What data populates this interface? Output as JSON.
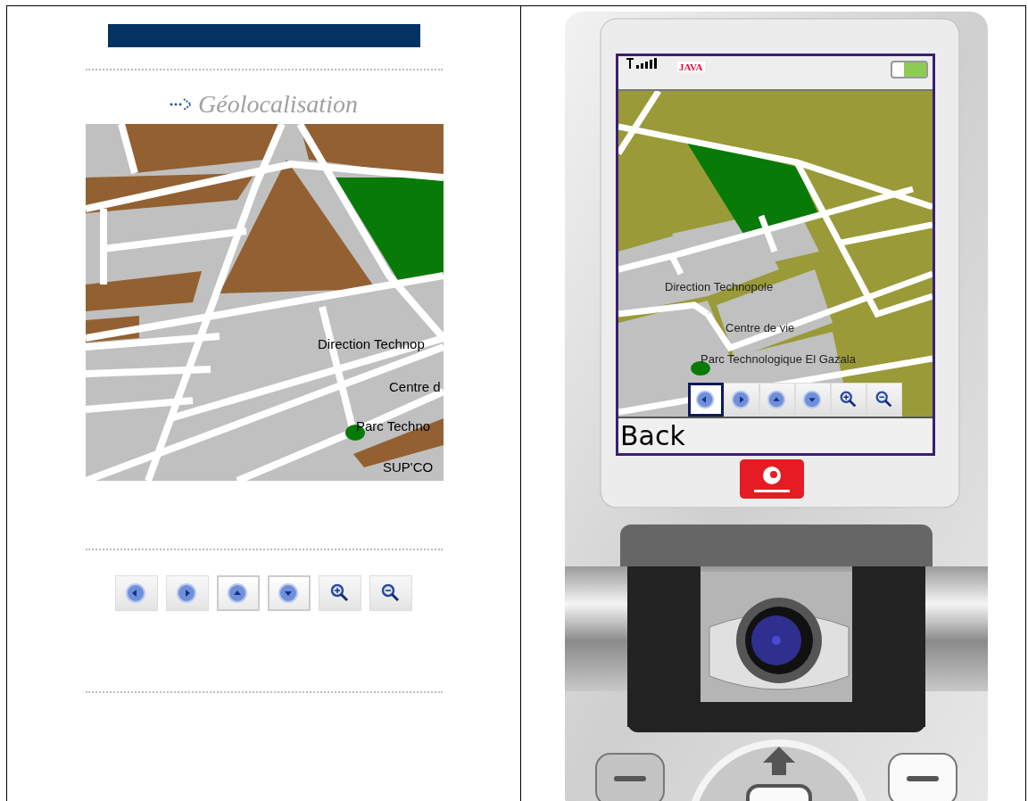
{
  "left_panel": {
    "title": "Géolocalisation",
    "map_labels": [
      {
        "kind": "direction",
        "text": "Direction Technop"
      },
      {
        "kind": "centre",
        "text": "Centre d"
      },
      {
        "kind": "parc",
        "text": "Parc Techno"
      },
      {
        "kind": "supcom",
        "text": "SUP'CO"
      }
    ],
    "toolbar": [
      {
        "kind": "left"
      },
      {
        "kind": "right"
      },
      {
        "kind": "up"
      },
      {
        "kind": "down"
      },
      {
        "kind": "zoom-in"
      },
      {
        "kind": "zoom-out"
      }
    ]
  },
  "phone": {
    "status_bar": {
      "logo": "JAVA"
    },
    "map_labels": [
      {
        "kind": "direction",
        "text": "Direction Technopole"
      },
      {
        "kind": "centre",
        "text": "Centre de vie"
      },
      {
        "kind": "parc",
        "text": "Parc Technologique El Gazala"
      }
    ],
    "toolbar": [
      {
        "kind": "left",
        "selected": true
      },
      {
        "kind": "right",
        "selected": false
      },
      {
        "kind": "up",
        "selected": false
      },
      {
        "kind": "down",
        "selected": false
      },
      {
        "kind": "zoom-in",
        "selected": false
      },
      {
        "kind": "zoom-out",
        "selected": false
      }
    ],
    "softkey": "Back"
  }
}
